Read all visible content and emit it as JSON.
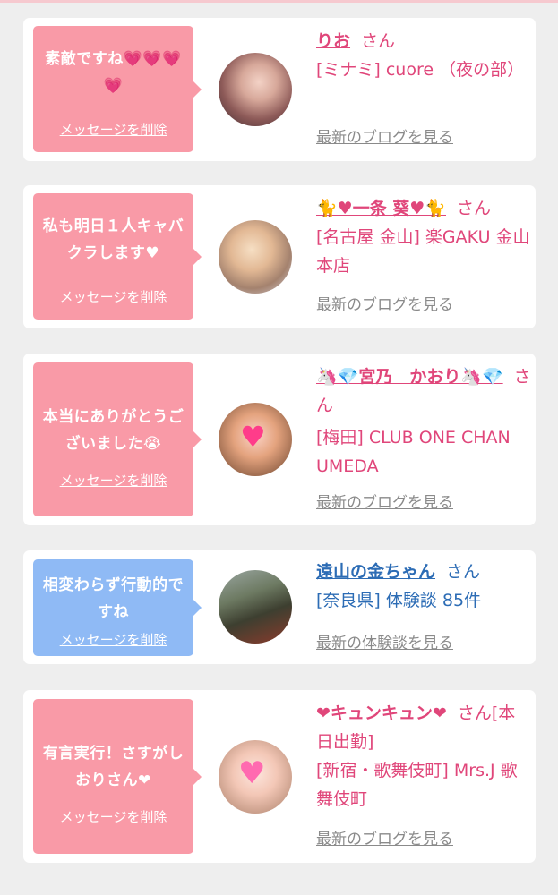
{
  "cards": [
    {
      "message": "素敵ですね💗💗💗💗",
      "delete_label": "メッセージを削除",
      "name": "りお",
      "honorific": "さん",
      "shop": "[ミナミ] cuore （夜の部）",
      "link": "最新のブログを見る",
      "theme": "pink"
    },
    {
      "message": "私も明日１人キャバクラします♥",
      "delete_label": "メッセージを削除",
      "name": "🐈♥一条 葵♥🐈",
      "honorific": "さん",
      "shop": "[名古屋 金山] 楽GAKU 金山本店",
      "link": "最新のブログを見る",
      "theme": "pink"
    },
    {
      "message": "本当にありがとうございました😭",
      "delete_label": "メッセージを削除",
      "name": "🦄💎宮乃　かおり🦄💎",
      "honorific": "さん",
      "shop": "[梅田] CLUB ONE CHAN UMEDA",
      "link": "最新のブログを見る",
      "theme": "pink"
    },
    {
      "message": "相変わらず行動的ですね",
      "delete_label": "メッセージを削除",
      "name": "遠山の金ちゃん",
      "honorific": "さん",
      "shop": "[奈良県] 体験談 85件",
      "link": "最新の体験談を見る",
      "theme": "blue"
    },
    {
      "message": "有言実行！さすがしおりさん❤",
      "delete_label": "メッセージを削除",
      "name": "❤キュンキュン❤",
      "honorific": "さん",
      "status": "[本日出勤]",
      "shop": "[新宿・歌舞伎町] Mrs.J 歌舞伎町",
      "link": "最新のブログを見る",
      "theme": "pink"
    }
  ],
  "colors": {
    "pink_bubble": "#f99aa7",
    "blue_bubble": "#8fbaf5",
    "pink_text": "#e0467a",
    "blue_text": "#2c6cb5",
    "link_gray": "#8a8a8a"
  }
}
